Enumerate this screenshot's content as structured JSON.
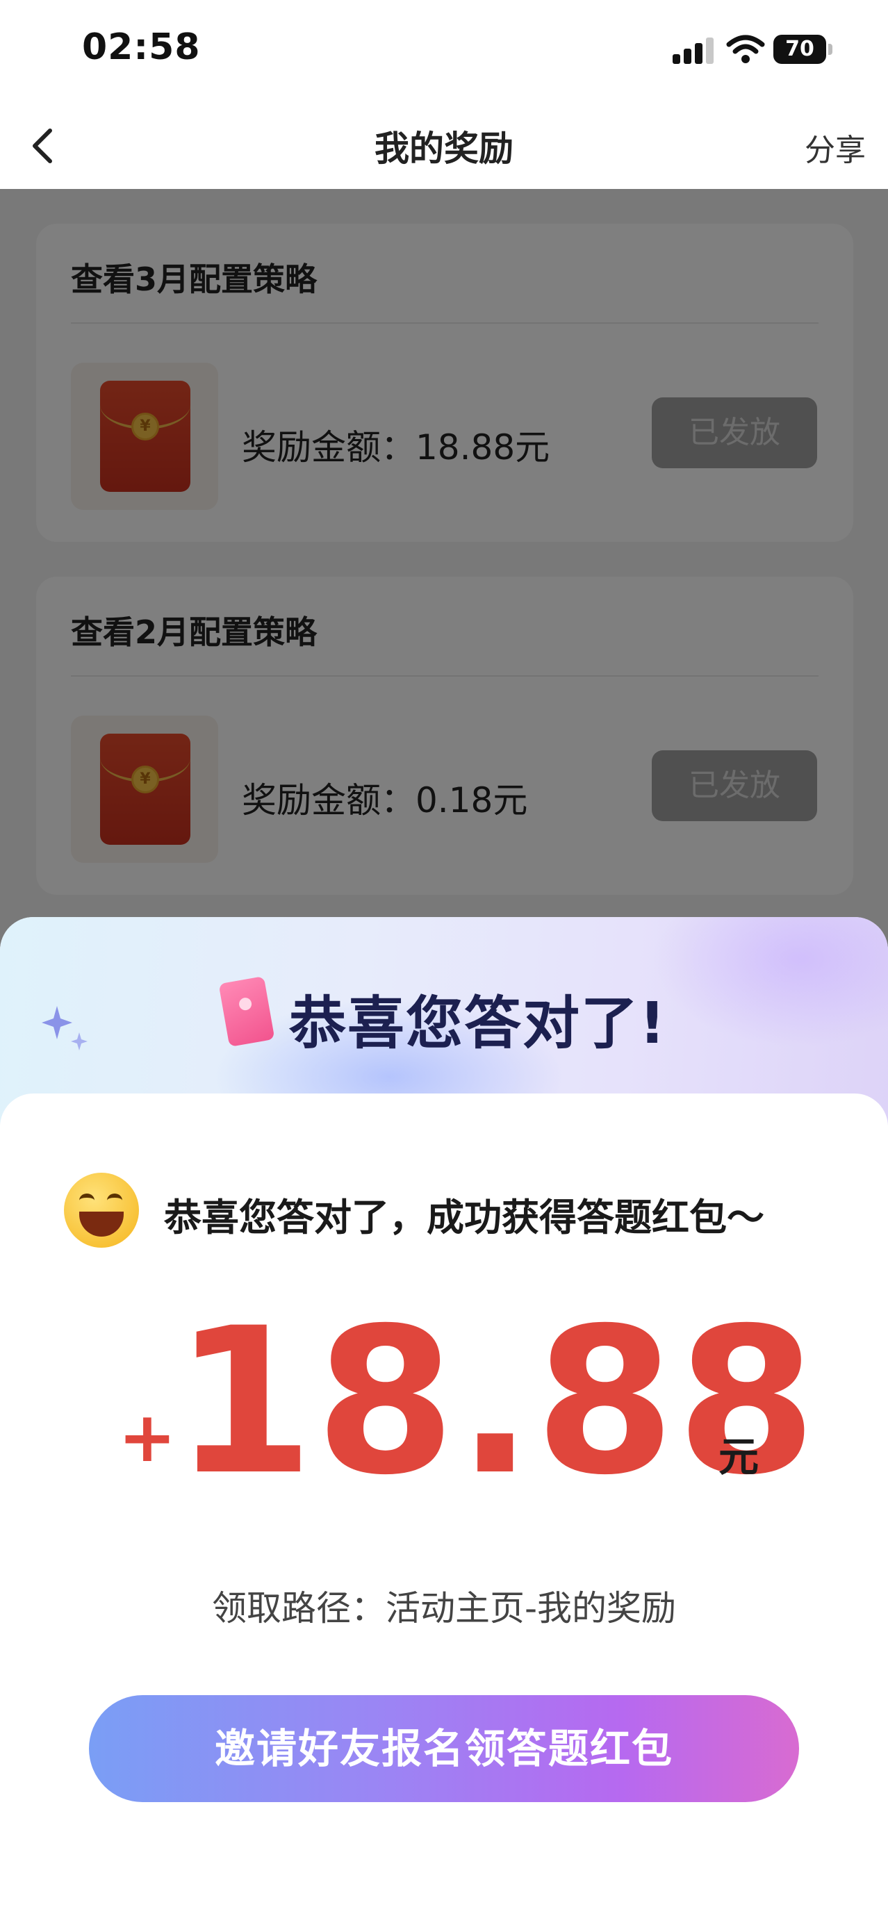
{
  "status_bar": {
    "time": "02:58",
    "battery": "70"
  },
  "nav": {
    "title": "我的奖励",
    "share_label": "分享"
  },
  "rewards": [
    {
      "title": "查看3月配置策略",
      "amount": "奖励金额：18.88元",
      "status": "已发放"
    },
    {
      "title": "查看2月配置策略",
      "amount": "奖励金额：0.18元",
      "status": "已发放"
    }
  ],
  "sheet": {
    "title": "恭喜您答对了!",
    "message": "恭喜您答对了，成功获得答题红包～",
    "plus": "+",
    "amount": "18.88",
    "unit": "元",
    "path_text": "领取路径：活动主页-我的奖励",
    "cta_label": "邀请好友报名领答题红包"
  },
  "colors": {
    "accent_red": "#e0463c",
    "cta_start": "#7a9ef5",
    "cta_end": "#d86bd1",
    "issued_button": "#a0a0a0"
  }
}
